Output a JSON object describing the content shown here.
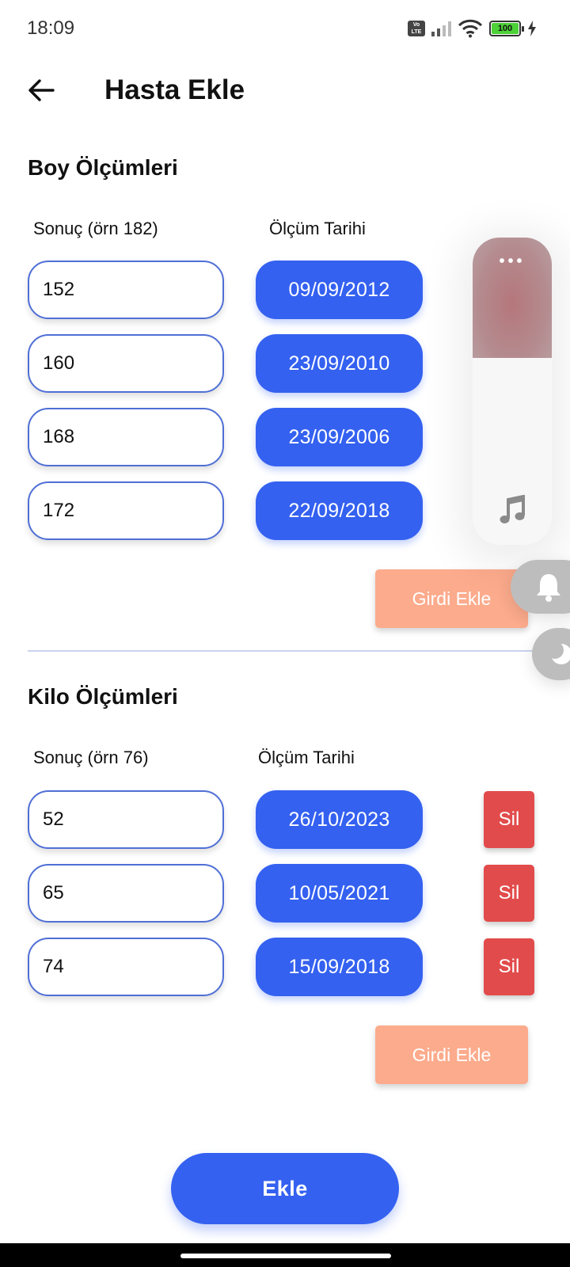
{
  "status_bar": {
    "time": "18:09",
    "volte_label": "Vo\nLTE",
    "battery_level": "100"
  },
  "header": {
    "title": "Hasta Ekle",
    "back_icon": "arrow-left-icon"
  },
  "height_section": {
    "title": "Boy Ölçümleri",
    "value_label": "Sonuç (örn 182)",
    "date_label": "Ölçüm Tarihi",
    "rows": [
      {
        "value": "152",
        "date": "09/09/2012"
      },
      {
        "value": "160",
        "date": "23/09/2010"
      },
      {
        "value": "168",
        "date": "23/09/2006"
      },
      {
        "value": "172",
        "date": "22/09/2018"
      }
    ],
    "add_entry_label": "Girdi Ekle"
  },
  "weight_section": {
    "title": "Kilo Ölçümleri",
    "value_label": "Sonuç (örn 76)",
    "date_label": "Ölçüm Tarihi",
    "rows": [
      {
        "value": "52",
        "date": "26/10/2023",
        "delete_label": "Sil"
      },
      {
        "value": "65",
        "date": "10/05/2021",
        "delete_label": "Sil"
      },
      {
        "value": "74",
        "date": "15/09/2018",
        "delete_label": "Sil"
      }
    ],
    "add_entry_label": "Girdi Ekle"
  },
  "submit_label": "Ekle",
  "colors": {
    "primary": "#3461f0",
    "danger": "#e24b4b",
    "secondary": "#fcab8c",
    "input_border": "#4f6fd6"
  },
  "volume_overlay": {
    "dots": "•••",
    "icons": [
      "music-note-icon",
      "bell-icon",
      "moon-icon"
    ]
  }
}
